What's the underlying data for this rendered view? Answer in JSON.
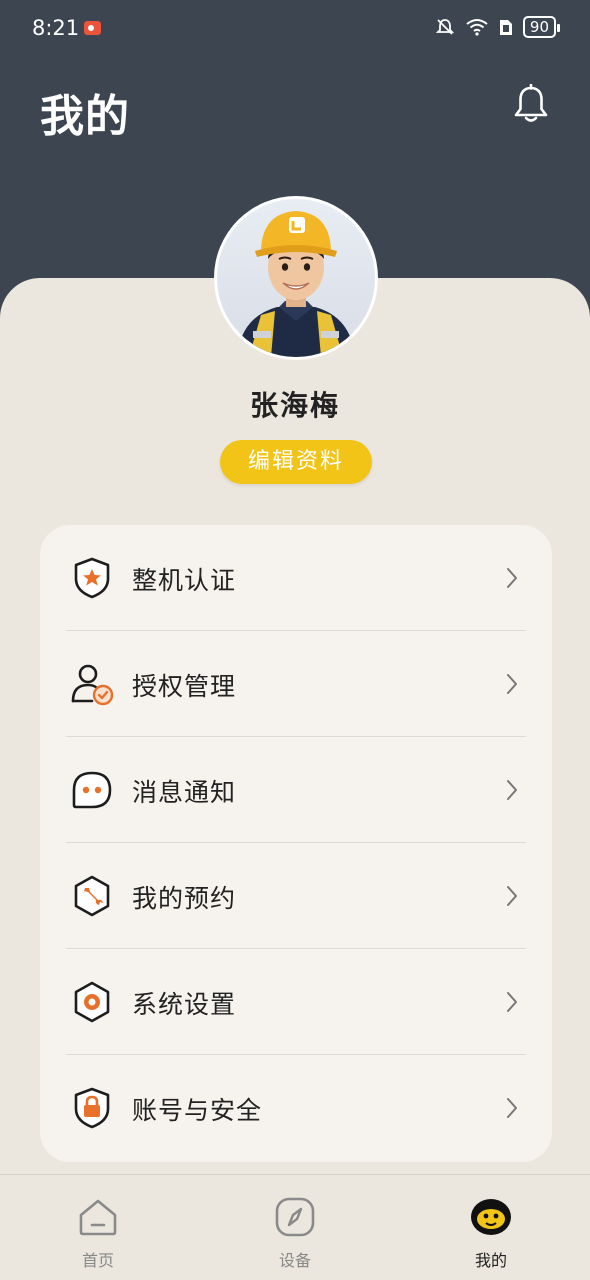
{
  "status_bar": {
    "time": "8:21",
    "battery": "90"
  },
  "header": {
    "title": "我的",
    "bell_icon": "bell-icon"
  },
  "profile": {
    "name": "张海梅",
    "edit_label": "编辑资料",
    "avatar_icon": "construction-worker-avatar"
  },
  "menu": {
    "items": [
      {
        "label": "整机认证",
        "icon": "certification-shield-icon"
      },
      {
        "label": "授权管理",
        "icon": "authorization-user-icon"
      },
      {
        "label": "消息通知",
        "icon": "message-bubble-icon"
      },
      {
        "label": "我的预约",
        "icon": "appointment-wrench-icon"
      },
      {
        "label": "系统设置",
        "icon": "settings-gear-icon"
      },
      {
        "label": "账号与安全",
        "icon": "account-lock-icon"
      }
    ]
  },
  "bottom_nav": {
    "items": [
      {
        "label": "首页",
        "icon": "home-icon",
        "active": false
      },
      {
        "label": "设备",
        "icon": "compass-icon",
        "active": false
      },
      {
        "label": "我的",
        "icon": "profile-face-icon",
        "active": true
      }
    ]
  },
  "colors": {
    "header_bg": "#3c4550",
    "panel_bg": "#ebe7df",
    "card_bg": "#f6f3ee",
    "accent_yellow": "#f2c417",
    "icon_orange": "#e8702a"
  }
}
